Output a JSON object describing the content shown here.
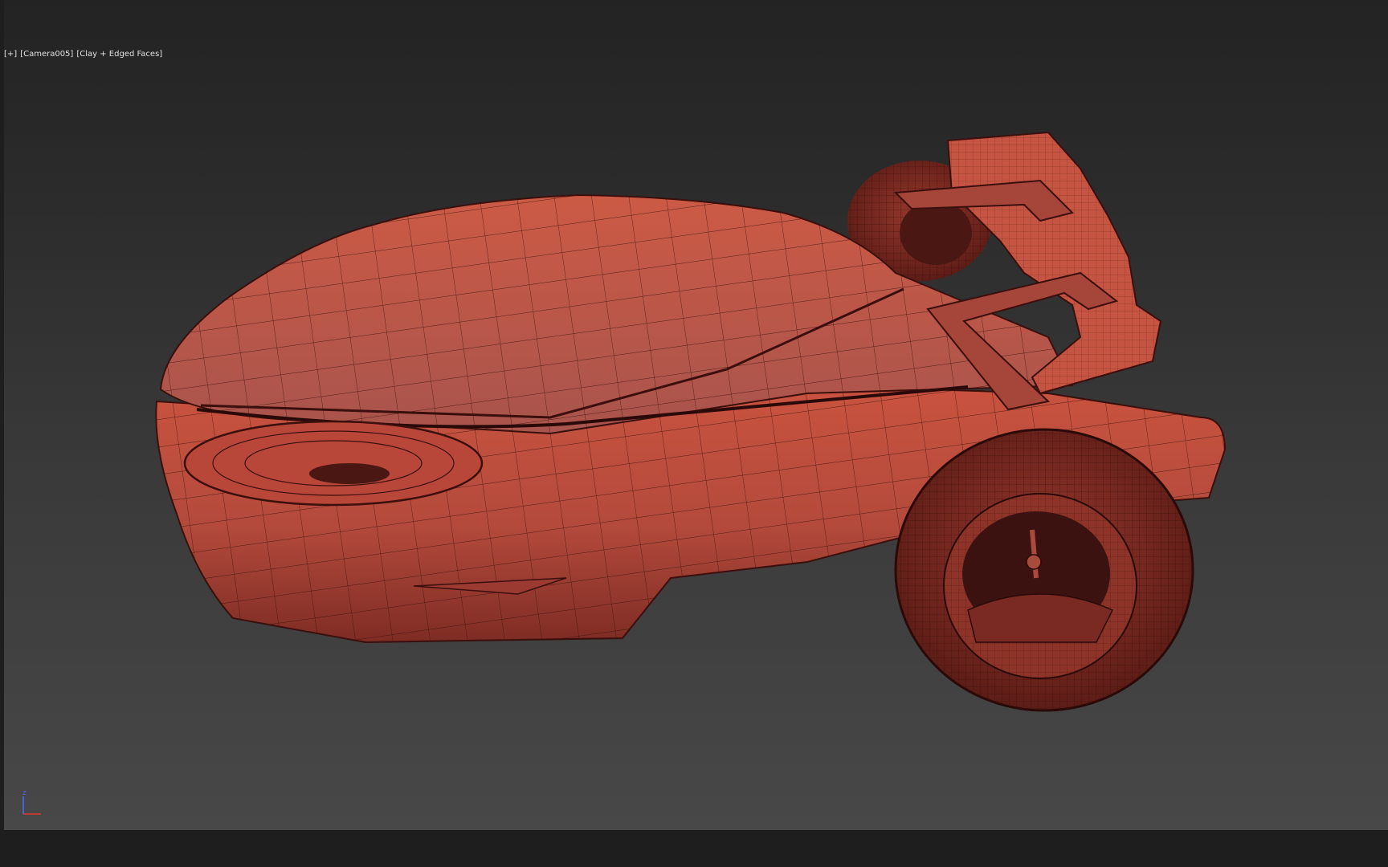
{
  "viewport": {
    "menu_plus": "[+]",
    "camera": "[Camera005]",
    "shading": "[Clay + Edged Faces]"
  },
  "scene": {
    "object_color": "#b8473a",
    "wire_color": "#3a0f0c",
    "background_top": "#232323",
    "background_bottom": "#484848"
  },
  "gizmo": {
    "z_label": "Z",
    "z_color": "#4a6cff",
    "x_color": "#e03a2a"
  }
}
